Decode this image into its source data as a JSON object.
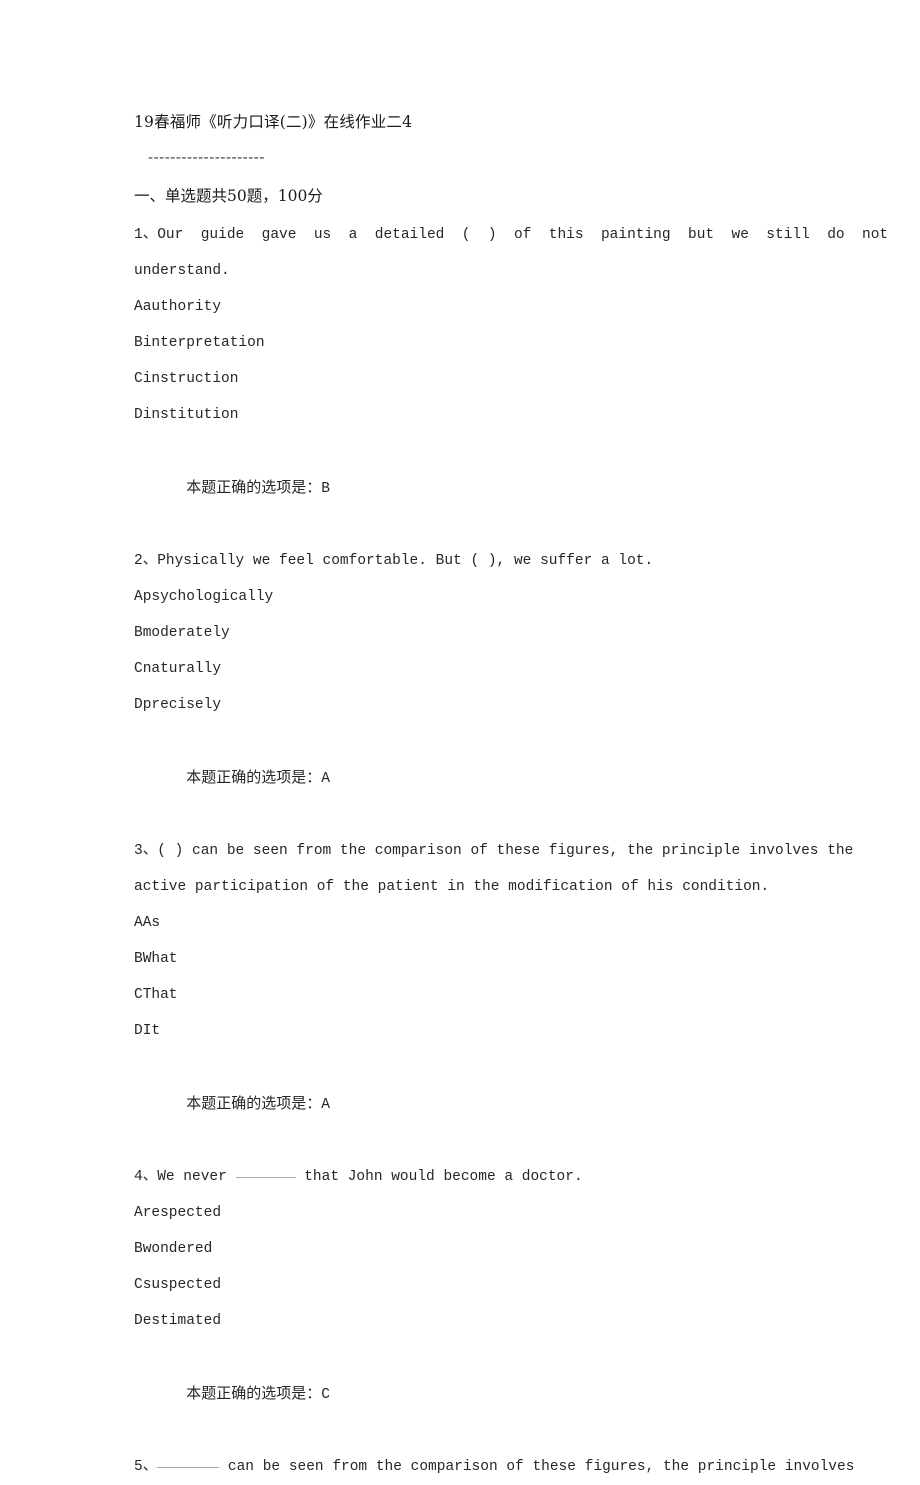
{
  "document": {
    "title": "19春福师《听力口译(二)》在线作业二4",
    "separator": "---------------------",
    "section_heading": "一、单选题共50题，100分",
    "answer_label": "本题正确的选项是：",
    "questions": [
      {
        "number": "1、",
        "stem": "Our guide gave us a detailed ( ) of this painting but we still do not understand.",
        "stem_line1": "1、Our  guide  gave  us  a  detailed  (  )  of  this  painting  but  we  still  do  not",
        "stem_line2": "understand.",
        "has_blank": false,
        "options": [
          "Aauthority",
          "Binterpretation",
          "Cinstruction",
          "Dinstitution"
        ],
        "answer": "B"
      },
      {
        "number": "2、",
        "stem": "Physically we feel comfortable. But ( ), we suffer a lot.",
        "stem_line1": "2、Physically we feel comfortable. But ( ), we suffer a lot.",
        "stem_line2": "",
        "has_blank": false,
        "options": [
          "Apsychologically",
          "Bmoderately",
          "Cnaturally",
          "Dprecisely"
        ],
        "answer": "A"
      },
      {
        "number": "3、",
        "stem": "( ) can be seen from the comparison of these figures, the principle involves the active participation of the patient in the modification of his condition.",
        "stem_line1": "3、( ) can be seen from the comparison of these figures, the principle involves the",
        "stem_line2": "active participation of the patient in the modification of his condition.",
        "has_blank": false,
        "options": [
          "AAs",
          "BWhat",
          "CThat",
          "DIt"
        ],
        "answer": "A"
      },
      {
        "number": "4、",
        "stem_prefix": "4、We never ",
        "stem_suffix": " that John would become a doctor.",
        "has_blank": true,
        "options": [
          "Arespected",
          "Bwondered",
          "Csuspected",
          "Destimated"
        ],
        "answer": "C"
      },
      {
        "number": "5、",
        "stem_prefix": "5、",
        "stem_suffix": " can be seen from the comparison of these figures, the principle involves",
        "has_blank": true,
        "options": [],
        "answer": ""
      }
    ]
  }
}
